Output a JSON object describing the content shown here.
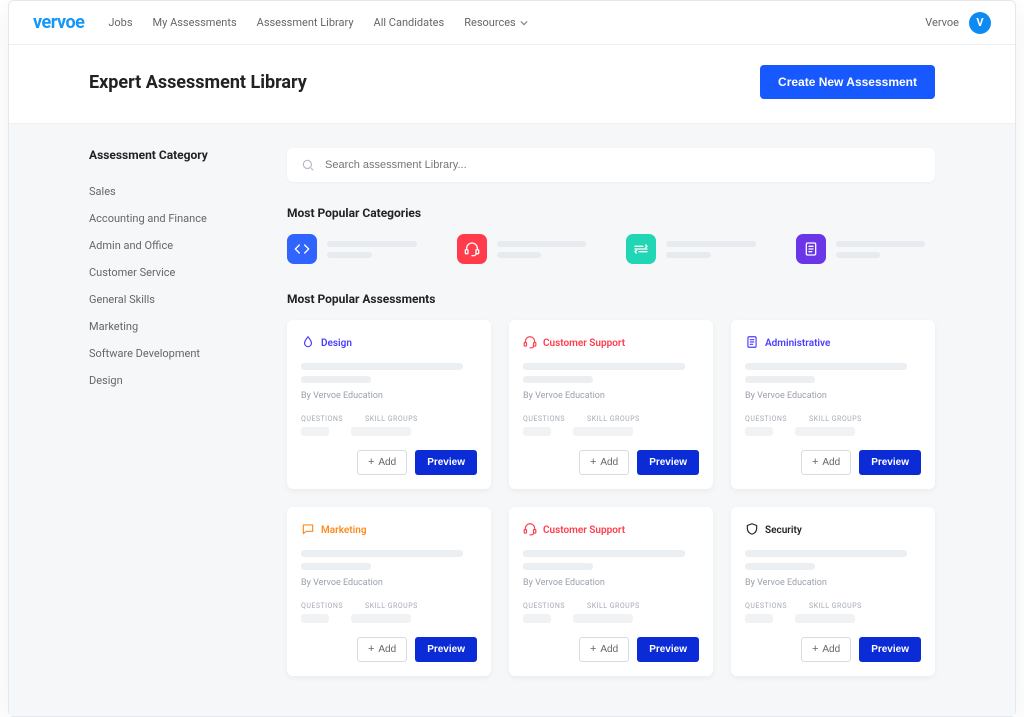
{
  "brand": "vervoe",
  "nav": {
    "items": [
      "Jobs",
      "My Assessments",
      "Assessment Library",
      "All Candidates",
      "Resources"
    ]
  },
  "user": {
    "name": "Vervoe",
    "initial": "V"
  },
  "header": {
    "title": "Expert Assessment Library",
    "cta": "Create New Assessment"
  },
  "sidebar": {
    "title": "Assessment Category",
    "items": [
      "Sales",
      "Accounting and Finance",
      "Admin and Office",
      "Customer Service",
      "General Skills",
      "Marketing",
      "Software Development",
      "Design"
    ]
  },
  "search": {
    "placeholder": "Search assessment Library..."
  },
  "sections": {
    "popular_categories": "Most Popular Categories",
    "popular_assessments": "Most Popular Assessments"
  },
  "popular_categories": [
    {
      "icon": "code",
      "bg": "#2f64ff"
    },
    {
      "icon": "headset",
      "bg": "#ff3b4c"
    },
    {
      "icon": "money",
      "bg": "#21d6b4"
    },
    {
      "icon": "doc",
      "bg": "#6b35e8"
    }
  ],
  "card_common": {
    "by": "By Vervoe Education",
    "meta1": "QUESTIONS",
    "meta2": "SKILL GROUPS",
    "add": "Add",
    "preview": "Preview"
  },
  "cards": [
    {
      "tag": "Design",
      "color": "#4b3cff",
      "icon": "drop"
    },
    {
      "tag": "Customer Support",
      "color": "#ff3b4c",
      "icon": "headset"
    },
    {
      "tag": "Administrative",
      "color": "#4b3cff",
      "icon": "doc"
    },
    {
      "tag": "Marketing",
      "color": "#ff8a1f",
      "icon": "chat"
    },
    {
      "tag": "Customer Support",
      "color": "#ff3b4c",
      "icon": "headset"
    },
    {
      "tag": "Security",
      "color": "#222",
      "icon": "shield"
    }
  ]
}
